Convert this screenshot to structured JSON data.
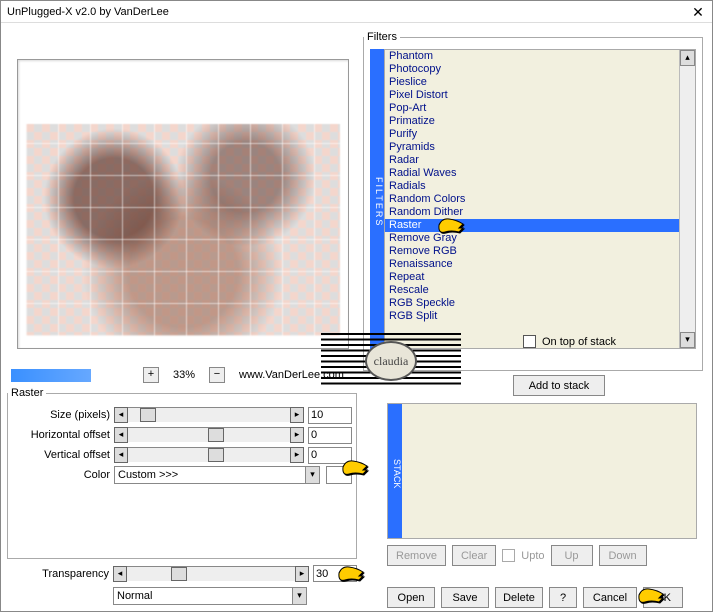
{
  "title": "UnPlugged-X v2.0 by VanDerLee",
  "zoom": {
    "percent": "33%",
    "link": "www.VanDerLee.com"
  },
  "filters": {
    "legend": "Filters",
    "ontop_label": "On top of stack",
    "add_label": "Add to stack",
    "items": [
      "Phantom",
      "Photocopy",
      "Pieslice",
      "Pixel Distort",
      "Pop-Art",
      "Primatize",
      "Purify",
      "Pyramids",
      "Radar",
      "Radial Waves",
      "Radials",
      "Random Colors",
      "Random Dither",
      "Raster",
      "Remove Gray",
      "Remove RGB",
      "Renaissance",
      "Repeat",
      "Rescale",
      "RGB Speckle",
      "RGB Split"
    ],
    "selected": "Raster"
  },
  "raster": {
    "legend": "Raster",
    "size_label": "Size (pixels)",
    "size_value": "10",
    "hoff_label": "Horizontal offset",
    "hoff_value": "0",
    "voff_label": "Vertical offset",
    "voff_value": "0",
    "color_label": "Color",
    "color_option": "Custom >>>"
  },
  "transparency": {
    "label": "Transparency",
    "value": "30"
  },
  "blend": {
    "option": "Normal"
  },
  "stack": {
    "vlabel": "STACK",
    "remove": "Remove",
    "clear": "Clear",
    "upto": "Upto",
    "up": "Up",
    "down": "Down"
  },
  "flt_vlabel": "FILTERS",
  "bottom": {
    "open": "Open",
    "save": "Save",
    "delete": "Delete",
    "help": "?",
    "cancel": "Cancel",
    "ok": "OK"
  },
  "logo": "claudia"
}
